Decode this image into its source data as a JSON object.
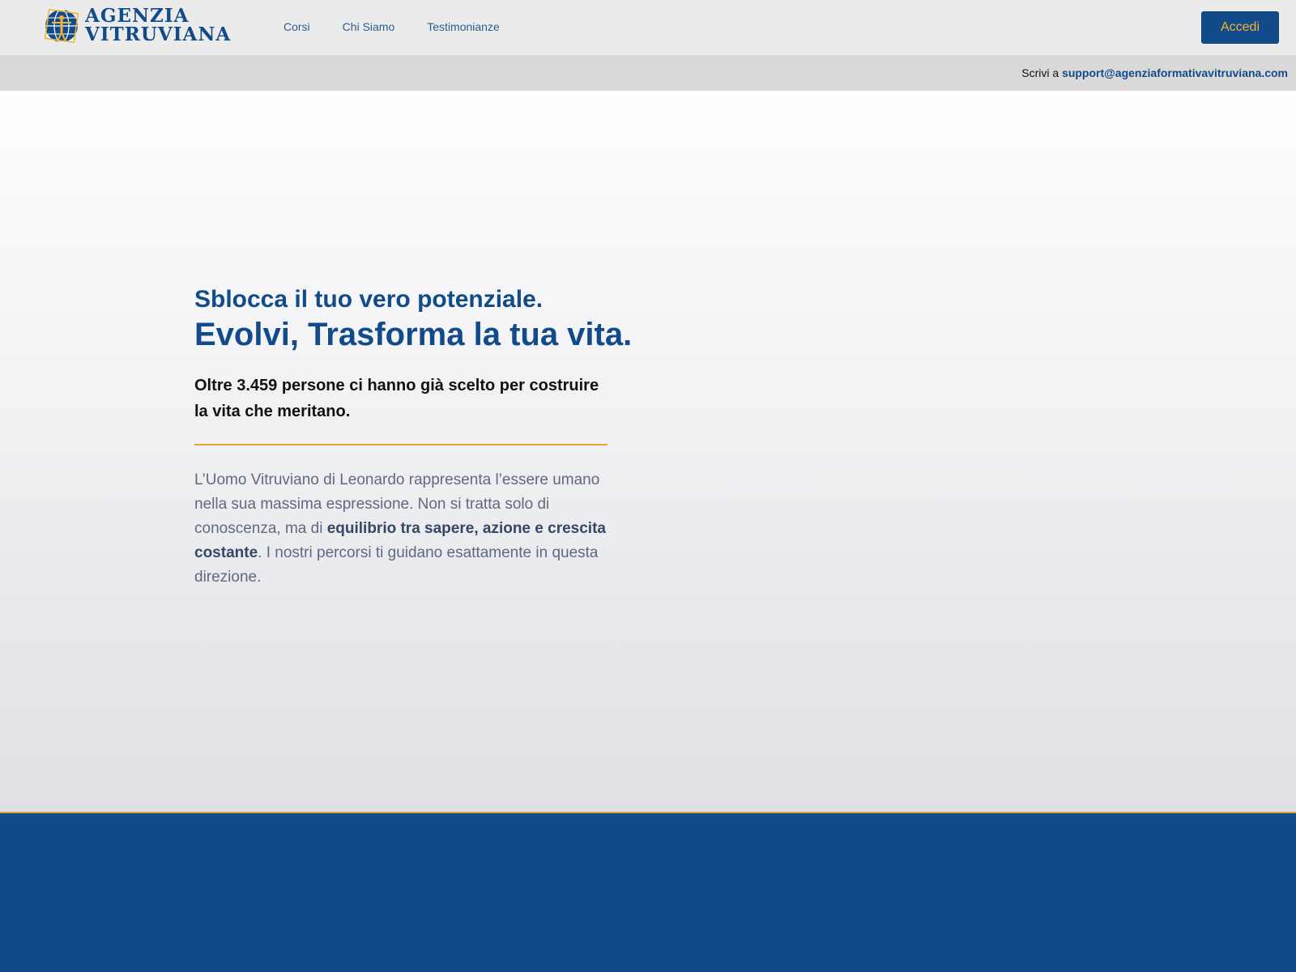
{
  "header": {
    "logo": {
      "line1": "AGENZIA",
      "line2": "VITRUVIANA"
    },
    "nav": [
      {
        "label": "Corsi"
      },
      {
        "label": "Chi Siamo"
      },
      {
        "label": "Testimonianze"
      }
    ],
    "login_label": "Accedi"
  },
  "support": {
    "prefix": "Scrivi a",
    "email": "support@agenziaformativavitruviana.com"
  },
  "hero": {
    "title_line1": "Sblocca il tuo vero potenziale.",
    "title_line2": "Evolvi, Trasforma la tua vita.",
    "lead": "Oltre 3.459 persone ci hanno già scelto per costruire la vita che meritano.",
    "body_part1": "L’Uomo Vitruviano di Leonardo rappresenta l’essere umano nella sua massima espressione. Non si tratta solo di conoscenza, ma di ",
    "body_strong": "equilibrio tra sapere, azione e crescita costante",
    "body_part2": ". I nostri percorsi ti guidano esattamente in questa direzione."
  },
  "colors": {
    "brand_blue": "#124b8a",
    "accent_gold": "#e4a43a",
    "button_text": "#f2b232",
    "header_bg": "#ebebeb",
    "support_bar_bg": "#d9d9d9"
  },
  "icons": {
    "logo_mark": "vitruvian-globe-icon"
  }
}
